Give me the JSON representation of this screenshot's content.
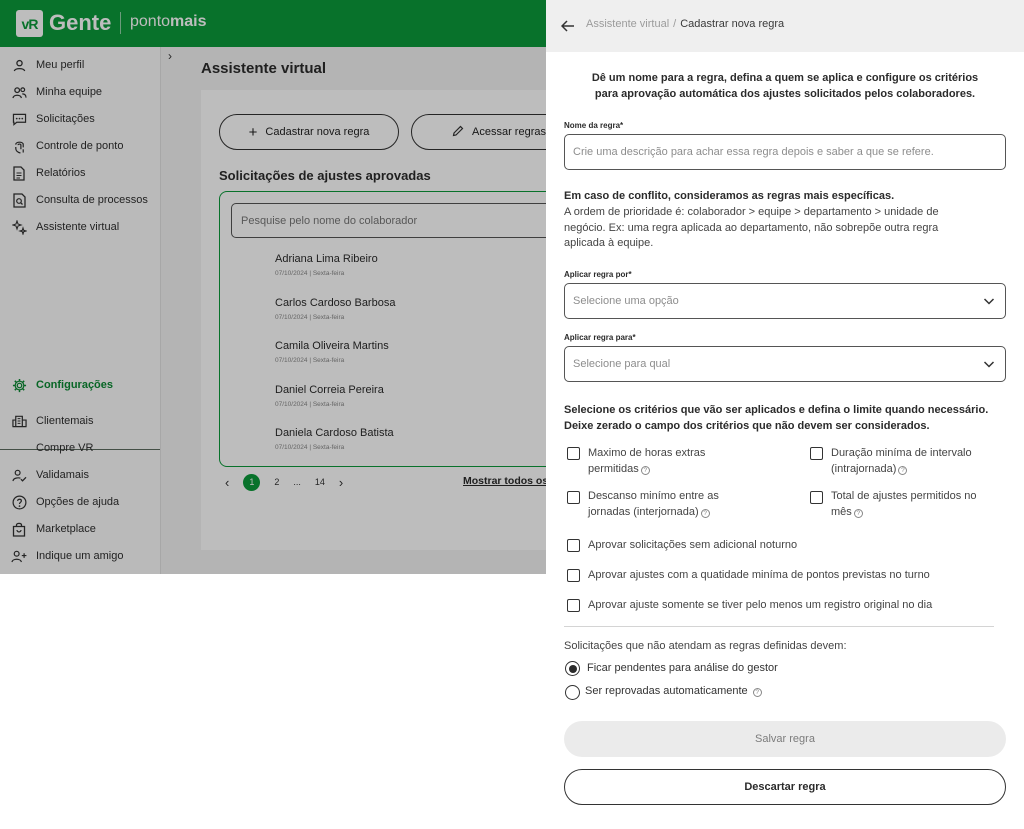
{
  "brand": {
    "logo_mark": "vR",
    "name": "Gente",
    "product_prefix": "ponto",
    "product_suffix": "mais"
  },
  "sidebar": {
    "items": [
      {
        "label": "Meu perfil",
        "icon": "user-icon"
      },
      {
        "label": "Minha equipe",
        "icon": "team-icon"
      },
      {
        "label": "Solicitações",
        "icon": "chat-icon"
      },
      {
        "label": "Controle de ponto",
        "icon": "fingerprint-icon"
      },
      {
        "label": "Relatórios",
        "icon": "report-icon"
      },
      {
        "label": "Consulta de processos",
        "icon": "search-document-icon"
      },
      {
        "label": "Assistente virtual",
        "icon": "sparkle-icon"
      }
    ],
    "settings": {
      "label": "Configurações",
      "icon": "gear-icon"
    },
    "bottom_items": [
      {
        "label": "Clientemais",
        "icon": "building-icon"
      },
      {
        "label": "Compre VR",
        "icon": ""
      },
      {
        "label": "Validamais",
        "icon": "user-check-icon"
      },
      {
        "label": "Opções de ajuda",
        "icon": "help-icon"
      },
      {
        "label": "Marketplace",
        "icon": "bag-icon"
      },
      {
        "label": "Indique um amigo",
        "icon": "user-add-icon"
      }
    ]
  },
  "main": {
    "title": "Assistente virtual",
    "new_rule_button": "Cadastrar nova regra",
    "access_rules_button": "Acessar regras",
    "approved_title": "Solicitações de ajustes aprovadas",
    "search_placeholder": "Pesquise pelo nome do colaborador",
    "employees": [
      {
        "name": "Adriana Lima Ribeiro",
        "date": "07/10/2024 | Sexta-feira"
      },
      {
        "name": "Carlos Cardoso Barbosa",
        "date": "07/10/2024 | Sexta-feira"
      },
      {
        "name": "Camila Oliveira Martins",
        "date": "07/10/2024 | Sexta-feira"
      },
      {
        "name": "Daniel Correia Pereira",
        "date": "07/10/2024 | Sexta-feira"
      },
      {
        "name": "Daniela Cardoso Batista",
        "date": "07/10/2024 | Sexta-feira"
      }
    ],
    "pagination": {
      "prev": "‹",
      "current": "1",
      "p2": "2",
      "ellipsis": "...",
      "last": "14",
      "next": "›"
    },
    "show_all": "Mostrar todos os"
  },
  "drawer": {
    "breadcrumb": {
      "parent": "Assistente virtual",
      "separator": "/",
      "current": "Cadastrar nova regra"
    },
    "intro_line1": "Dê um nome para a regra, defina a quem se aplica e configure os critérios",
    "intro_line2": "para aprovação automática dos ajustes solicitados pelos colaboradores.",
    "rule_name": {
      "label": "Nome da regra*",
      "placeholder": "Crie uma descrição para achar essa regra depois e saber a que se refere."
    },
    "conflict": {
      "title": "Em caso de conflito, consideramos as regras mais específicas.",
      "line1": "A ordem de prioridade é: colaborador > equipe > departamento > unidade de",
      "line2": "negócio. Ex: uma regra aplicada ao departamento, não sobrepõe outra regra",
      "line3": "aplicada à equipe."
    },
    "apply_by": {
      "label": "Aplicar regra por*",
      "placeholder": "Selecione uma opção"
    },
    "apply_to": {
      "label": "Aplicar regra para*",
      "placeholder": "Selecione para qual"
    },
    "criteria_line1": "Selecione os critérios que vão ser aplicados e defina o limite quando necessário.",
    "criteria_line2": "Deixe zerado o campo dos critérios que não devem ser considerados.",
    "criteria": {
      "max_overtime_1": "Maximo de horas extras",
      "max_overtime_2": "permitidas",
      "min_interval_1": "Duração miníma de intervalo",
      "min_interval_2": "(intrajornada)",
      "min_rest_1": "Descanso minímo entre as",
      "min_rest_2": "jornadas (interjornada)",
      "total_adjust_1": "Total de ajustes permitidos no",
      "total_adjust_2": "mês",
      "no_night": "Aprovar solicitações sem adicional noturno",
      "min_points": "Aprovar ajustes com a quatidade miníma de pontos previstas no turno",
      "original_record": "Aprovar ajuste somente se tiver pelo menos um registro original no dia"
    },
    "reject_question": "Solicitações que não atendam as regras definidas devem:",
    "options": {
      "pending": "Ficar pendentes para análise do gestor",
      "reject": "Ser reprovadas automaticamente",
      "selected": "pending"
    },
    "save_button": "Salvar regra",
    "discard_button": "Descartar regra"
  },
  "colors": {
    "brand_green": "#0c9a3a",
    "active_green": "#0c8a34"
  }
}
